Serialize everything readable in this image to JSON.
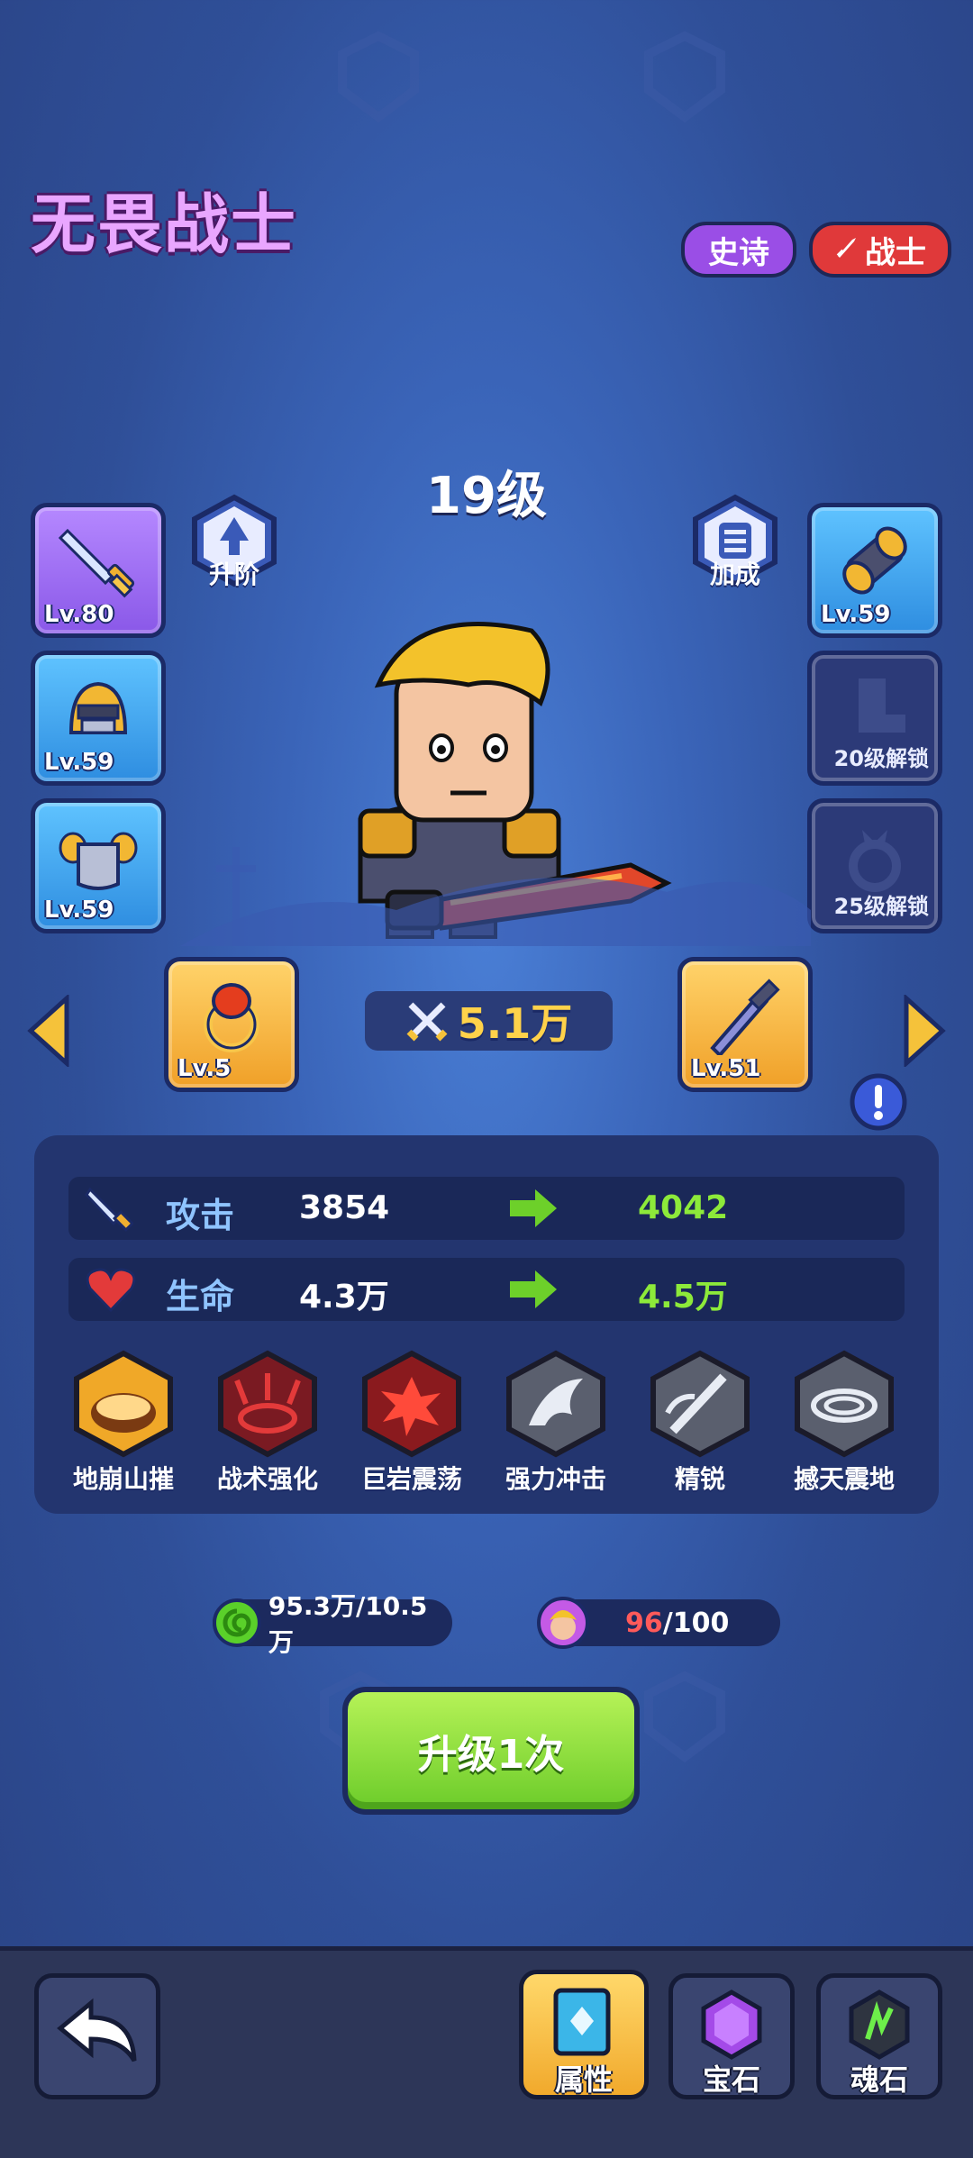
{
  "hero": {
    "name": "无畏战士",
    "rarity": "史诗",
    "class": "战士",
    "level_title": "19级"
  },
  "buttons": {
    "advance": "升阶",
    "bonus": "加成"
  },
  "equipment_left": [
    {
      "name": "sword",
      "level": "Lv.80"
    },
    {
      "name": "helmet",
      "level": "Lv.59"
    },
    {
      "name": "armor",
      "level": "Lv.59"
    }
  ],
  "equipment_right": [
    {
      "name": "bracer",
      "level": "Lv.59"
    },
    {
      "name": "boots",
      "lock": "20级解锁"
    },
    {
      "name": "ring",
      "lock": "25级解锁"
    }
  ],
  "bottom_items": {
    "ring_level": "Lv.5",
    "weapon_level": "Lv.51"
  },
  "power": "5.1万",
  "stats": [
    {
      "label": "攻击",
      "current": "3854",
      "next": "4042"
    },
    {
      "label": "生命",
      "current": "4.3万",
      "next": "4.5万"
    }
  ],
  "skills": [
    "地崩山摧",
    "战术强化",
    "巨岩震荡",
    "强力冲击",
    "精锐",
    "撼天震地"
  ],
  "resources": {
    "gold": "95.3万/10.5万",
    "shards_current": "96",
    "shards_total": "/100"
  },
  "upgrade_label": "升级1次",
  "nav": {
    "attributes": "属性",
    "gems": "宝石",
    "soulstones": "魂石"
  },
  "colors": {
    "rarity": "#9a4ee6",
    "class": "#e0393a",
    "green": "#8dea3a",
    "gold": "#ffd24a"
  }
}
